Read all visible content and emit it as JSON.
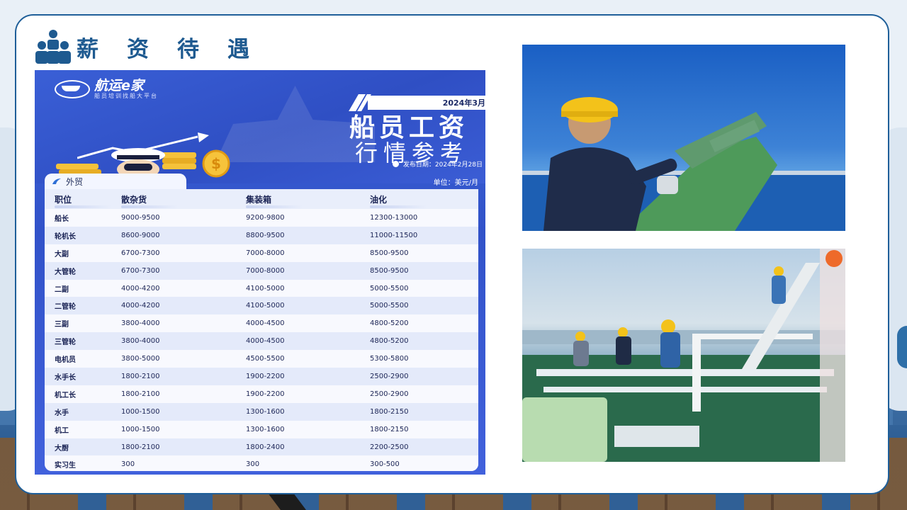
{
  "header": {
    "title": "薪资待遇",
    "icon": "people-group-icon"
  },
  "salary_card": {
    "logo_name": "航运e家",
    "logo_sub": "船员培训找船大平台",
    "date_bar": "2024年3月",
    "headline1": "船员工资",
    "headline2": "行情参考",
    "publish_date": "发布日期：2024年2月28日",
    "tab_label": "外贸",
    "unit": "单位：美元/月",
    "columns": [
      "职位",
      "散杂货",
      "集装箱",
      "油化"
    ],
    "rows": [
      [
        "船长",
        "9000-9500",
        "9200-9800",
        "12300-13000"
      ],
      [
        "轮机长",
        "8600-9000",
        "8800-9500",
        "11000-11500"
      ],
      [
        "大副",
        "6700-7300",
        "7000-8000",
        "8500-9500"
      ],
      [
        "大管轮",
        "6700-7300",
        "7000-8000",
        "8500-9500"
      ],
      [
        "二副",
        "4000-4200",
        "4100-5000",
        "5000-5500"
      ],
      [
        "二管轮",
        "4000-4200",
        "4100-5000",
        "5000-5500"
      ],
      [
        "三副",
        "3800-4000",
        "4000-4500",
        "4800-5200"
      ],
      [
        "三管轮",
        "3800-4000",
        "4000-4500",
        "4800-5200"
      ],
      [
        "电机员",
        "3800-5000",
        "4500-5500",
        "5300-5800"
      ],
      [
        "水手长",
        "1800-2100",
        "1900-2200",
        "2500-2900"
      ],
      [
        "机工长",
        "1800-2100",
        "1900-2200",
        "2500-2900"
      ],
      [
        "水手",
        "1000-1500",
        "1300-1600",
        "1800-2150"
      ],
      [
        "机工",
        "1000-1500",
        "1300-1600",
        "1800-2150"
      ],
      [
        "大厨",
        "1800-2100",
        "1800-2400",
        "2200-2500"
      ],
      [
        "实习生",
        "300",
        "300",
        "300-500"
      ]
    ]
  },
  "colors": {
    "brand_blue": "#1e5a90",
    "card_border": "#1f5f99",
    "poster_blue": "#3152c9"
  }
}
